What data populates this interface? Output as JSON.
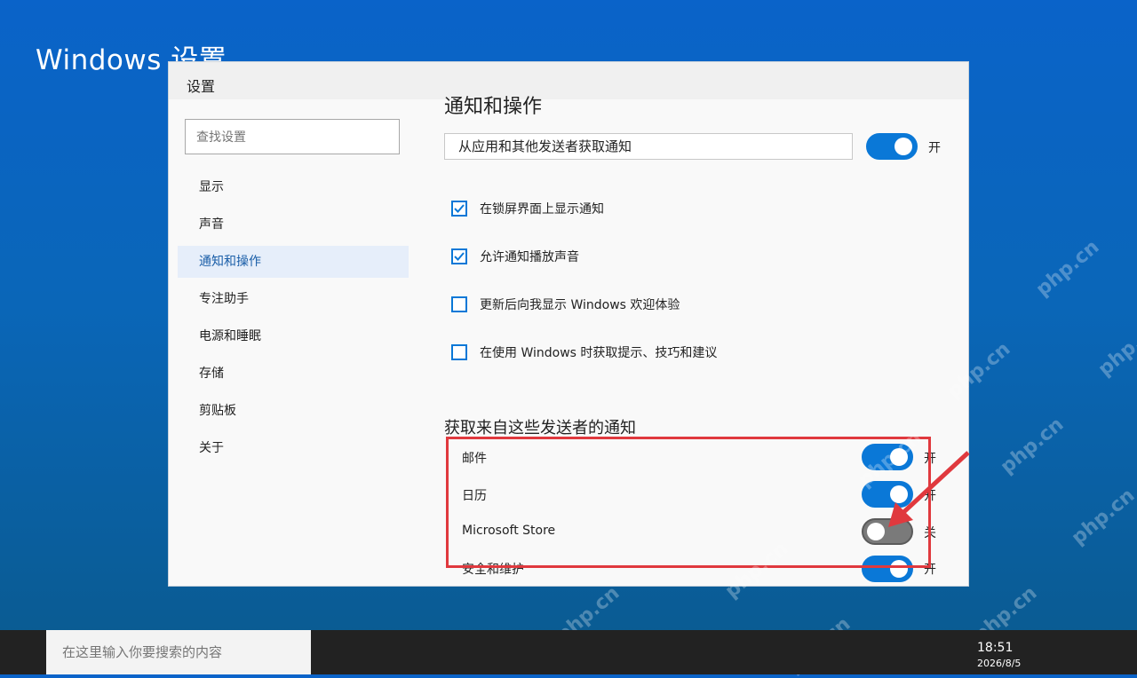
{
  "desktop": {
    "title": "Windows 设置"
  },
  "window": {
    "title": "设置"
  },
  "sidebar": {
    "search_placeholder": "查找设置",
    "items": [
      {
        "label": "显示"
      },
      {
        "label": "声音"
      },
      {
        "label": "通知和操作",
        "active": true
      },
      {
        "label": "专注助手"
      },
      {
        "label": "电源和睡眠"
      },
      {
        "label": "存储"
      },
      {
        "label": "剪贴板"
      },
      {
        "label": "关于"
      }
    ]
  },
  "main": {
    "title": "通知和操作",
    "master": {
      "label": "从应用和其他发送者获取通知",
      "state": "开",
      "on": true
    },
    "checkboxes": [
      {
        "label": "在锁屏界面上显示通知",
        "checked": true
      },
      {
        "label": "允许通知播放声音",
        "checked": true
      },
      {
        "label": "更新后向我显示 Windows 欢迎体验",
        "checked": false
      },
      {
        "label": "在使用 Windows 时获取提示、技巧和建议",
        "checked": false
      }
    ],
    "senders_title": "获取来自这些发送者的通知",
    "senders": [
      {
        "label": "邮件",
        "state": "开",
        "on": true
      },
      {
        "label": "日历",
        "state": "开",
        "on": true
      },
      {
        "label": "Microsoft Store",
        "state": "关",
        "on": false
      },
      {
        "label": "安全和维护",
        "state": "开",
        "on": true
      }
    ]
  },
  "taskbar": {
    "search_placeholder": "在这里输入你要搜索的内容",
    "time": "18:51",
    "date": "2026/8/5"
  },
  "watermark": {
    "text": "php.cn"
  },
  "colors": {
    "accent": "#0a78d7",
    "annotation": "#e0393e",
    "off_toggle": "#7a7a7a"
  }
}
